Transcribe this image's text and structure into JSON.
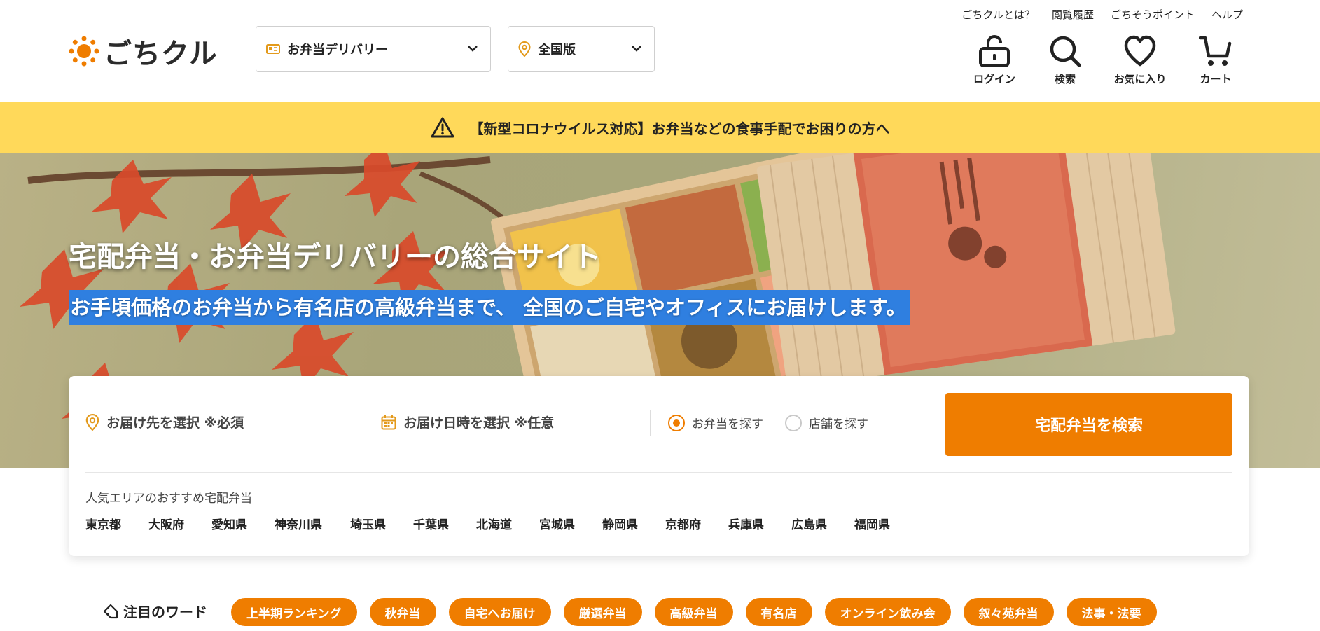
{
  "header": {
    "logo_text": "ごちクル",
    "service_select": "お弁当デリバリー",
    "area_select": "全国版",
    "toplinks": [
      "ごちクルとは？",
      "閲覧履歴",
      "ごちそうポイント",
      "ヘルプ"
    ],
    "nav": {
      "login": "ログイン",
      "search": "検索",
      "favorites": "お気に入り",
      "cart": "カート"
    }
  },
  "notice": {
    "text": "【新型コロナウイルス対応】お弁当などの食事手配でお困りの方へ"
  },
  "hero": {
    "title": "宅配弁当・お弁当デリバリーの総合サイト",
    "subtitle": "お手頃価格のお弁当から有名店の高級弁当まで、 全国のご自宅やオフィスにお届けします。"
  },
  "search": {
    "destination": "お届け先を選択 ※必須",
    "datetime": "お届け日時を選択 ※任意",
    "radio_bento": "お弁当を探す",
    "radio_shop": "店舗を探す",
    "button": "宅配弁当を検索",
    "popular_label": "人気エリアのおすすめ宅配弁当",
    "prefectures": [
      "東京都",
      "大阪府",
      "愛知県",
      "神奈川県",
      "埼玉県",
      "千葉県",
      "北海道",
      "宮城県",
      "静岡県",
      "京都府",
      "兵庫県",
      "広島県",
      "福岡県"
    ]
  },
  "keywords": {
    "label": "注目のワード",
    "chips": [
      "上半期ランキング",
      "秋弁当",
      "自宅へお届け",
      "厳選弁当",
      "高級弁当",
      "有名店",
      "オンライン飲み会",
      "叙々苑弁当",
      "法事・法要"
    ]
  },
  "colors": {
    "accent": "#ef7d00",
    "notice_bg": "#ffd95a",
    "highlight": "#2f7fe0"
  }
}
